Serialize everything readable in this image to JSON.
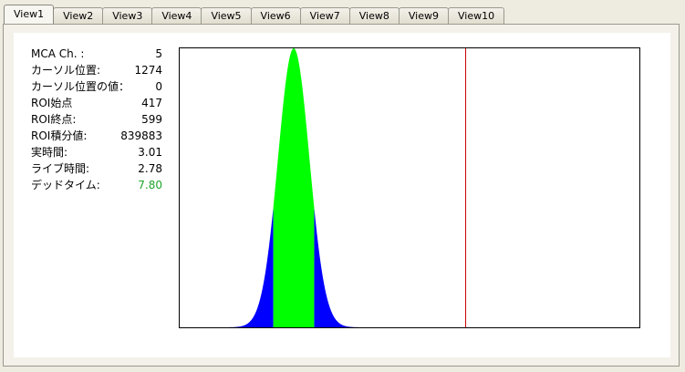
{
  "tabs": [
    {
      "label": "View1",
      "active": true
    },
    {
      "label": "View2",
      "active": false
    },
    {
      "label": "View3",
      "active": false
    },
    {
      "label": "View4",
      "active": false
    },
    {
      "label": "View5",
      "active": false
    },
    {
      "label": "View6",
      "active": false
    },
    {
      "label": "View7",
      "active": false
    },
    {
      "label": "View8",
      "active": false
    },
    {
      "label": "View9",
      "active": false
    },
    {
      "label": "View10",
      "active": false
    }
  ],
  "stats": [
    {
      "label": "MCA Ch. :",
      "value": "5"
    },
    {
      "label": "カーソル位置:",
      "value": "1274"
    },
    {
      "label": "カーソル位置の値：",
      "value": "0"
    },
    {
      "label": "ROI始点",
      "value": "417"
    },
    {
      "label": "ROI終点:",
      "value": "599"
    },
    {
      "label": "ROI積分値:",
      "value": "839883"
    },
    {
      "label": "実時間:",
      "value": "3.01"
    },
    {
      "label": "ライブ時間:",
      "value": "2.78"
    },
    {
      "label": "デッドタイム:",
      "value": "7.80",
      "highlight": "#1ea52c"
    }
  ],
  "colors": {
    "spectrum": "#0000ff",
    "roi": "#00ff00",
    "cursor": "#cc0000"
  },
  "chart_data": {
    "type": "area",
    "x_range": [
      0,
      2048
    ],
    "y_range": [
      0,
      1
    ],
    "peak_center": 508,
    "peak_sigma": 70,
    "roi": [
      417,
      599
    ],
    "cursor": 1274
  }
}
